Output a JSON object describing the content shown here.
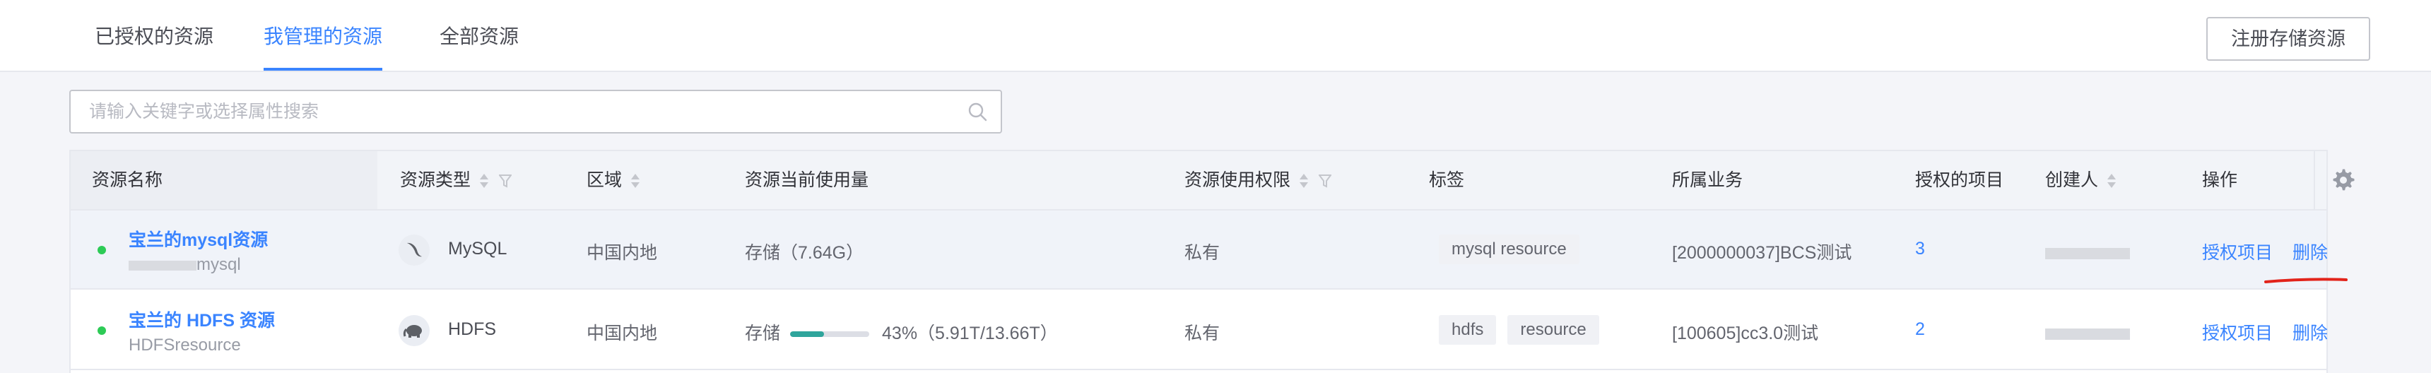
{
  "tabs": [
    {
      "label": "已授权的资源",
      "active": false
    },
    {
      "label": "我管理的资源",
      "active": true
    },
    {
      "label": "全部资源",
      "active": false
    }
  ],
  "register_button": "注册存储资源",
  "search": {
    "placeholder": "请输入关键字或选择属性搜索"
  },
  "table": {
    "headers": {
      "name": "资源名称",
      "type": "资源类型",
      "region": "区域",
      "usage": "资源当前使用量",
      "permission": "资源使用权限",
      "tags": "标签",
      "business": "所属业务",
      "projects": "授权的项目",
      "creator": "创建人",
      "actions": "操作"
    },
    "rows": [
      {
        "status": "normal",
        "name": "宝兰的mysql资源",
        "sub_suffix": "mysql",
        "type": "MySQL",
        "type_icon": "mysql-dolphin-icon",
        "region": "中国内地",
        "usage_text": "存储（7.64G）",
        "permission": "私有",
        "tags": [
          "mysql resource"
        ],
        "business": "[2000000037]BCS测试",
        "projects": "3",
        "action_authorize": "授权项目",
        "action_delete": "删除"
      },
      {
        "status": "normal",
        "name": "宝兰的 HDFS 资源",
        "sub": "HDFSresource",
        "type": "HDFS",
        "type_icon": "hdfs-elephant-icon",
        "region": "中国内地",
        "usage_label": "存储",
        "usage_percent": 43,
        "usage_text": "43%（5.91T/13.66T）",
        "permission": "私有",
        "tags": [
          "hdfs",
          "resource"
        ],
        "business": "[100605]cc3.0测试",
        "projects": "2",
        "action_authorize": "授权项目",
        "action_delete": "删除"
      }
    ]
  },
  "colors": {
    "accent": "#3a84ff",
    "status_ok": "#2dcb56",
    "annotation": "#e2231a",
    "progress": "#2fa59c"
  }
}
